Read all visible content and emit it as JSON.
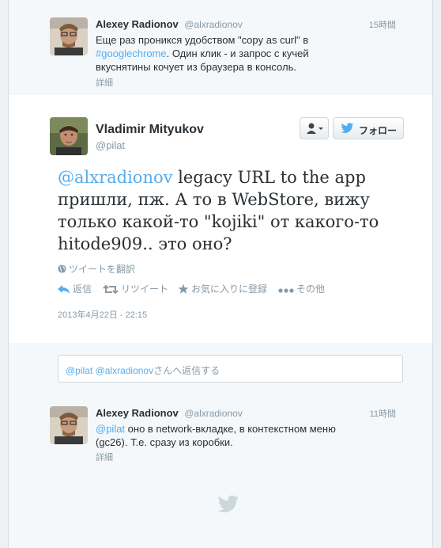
{
  "top_tweet": {
    "name": "Alexey Radionov",
    "handle": "@alxradionov",
    "time": "15時間",
    "text_before": "Еще раз проникся удобством \"copy as curl\" в",
    "hashtag": "#googlechrome",
    "text_after": ". Один клик - и запрос с кучей вкуснятины кочует из браузера в консоль.",
    "details": "詳細"
  },
  "focus_tweet": {
    "name": "Vladimir Mityukov",
    "handle": "@pilat",
    "follow_label": "フォロー",
    "mention": "@alxradionov",
    "text": " legacy URL to the app пришли, пж. А то в WebStore, вижу только какой-то \"kojiki\" от какого-то hitode909.. это оно?",
    "translate": "ツイートを翻訳",
    "actions": {
      "reply": "返信",
      "retweet": "リツイート",
      "favorite": "お気に入りに登録",
      "more": "その他"
    },
    "timestamp": "2013年4月22日 - 22:15"
  },
  "reply_box": {
    "mention1": "@pilat",
    "mention2": "@alxradionov",
    "suffix": "さんへ返信する"
  },
  "bottom_tweet": {
    "name": "Alexey Radionov",
    "handle": "@alxradionov",
    "time": "11時間",
    "mention": "@pilat",
    "text": " оно в network-вкладке, в контекстном меню (gc26). Т.е. сразу из коробки.",
    "details": "詳細"
  },
  "colors": {
    "link": "#55acee",
    "meta": "#8899a6",
    "text": "#292f33"
  }
}
